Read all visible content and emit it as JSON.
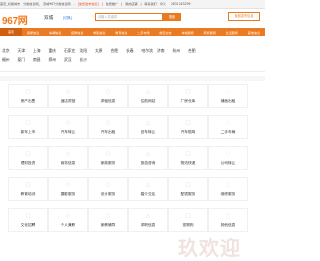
{
  "topbar": {
    "items": [
      "首页_切换城市",
      "分类信息网_",
      "双城967分类信息网",
      "-",
      "[免费发布信息]",
      "|",
      "免费推广",
      "|",
      "我的店铺",
      "|",
      "联系我们",
      "QQ：",
      "2831243299"
    ]
  },
  "header": {
    "logo_text": "967网",
    "city": "双城",
    "switch_city": "[切换]",
    "search_placeholder": "请输入关键词",
    "search_button": "搜索",
    "post_button": "免费发布信息"
  },
  "nav": {
    "items": [
      "首页",
      "房屋信息",
      "车辆信息",
      "招聘信息",
      "求职信息",
      "教育信息",
      "二手市场",
      "婚恋交友",
      "本地服务",
      "商务服务",
      "生活服务",
      "其他信息"
    ]
  },
  "cities": {
    "row1": [
      "北京",
      "天津",
      "上海",
      "重庆",
      "石家庄",
      "沈阳",
      "太原",
      "合肥",
      "长春",
      "哈尔滨",
      "济南",
      "杭州",
      "合肥"
    ],
    "row2": [
      "福州",
      "厦门",
      "南昌",
      "郑州",
      "武汉",
      "长沙"
    ]
  },
  "categories": [
    [
      "房产出售",
      "酒店宾馆",
      "求租信息",
      "住航网站",
      "厂房仓库",
      "铺面出租"
    ],
    [
      "新车上市",
      "汽车转让",
      "汽车出租",
      "旧车转让",
      "汽车陪驾",
      "二手车辆"
    ],
    [
      "理财投资",
      "商务信息",
      "家政服务",
      "旅游咨询",
      "物流快递",
      "公司转让"
    ],
    [
      "教育培训",
      "摄影服务",
      "设计服务",
      "婚介交友",
      "配镜服务",
      "维修服务"
    ],
    [
      "文化招聘",
      "个人兼职",
      "家教辅导",
      "求职信息",
      "宠物狗",
      "其他信息"
    ]
  ],
  "watermark": "玖欢迎"
}
